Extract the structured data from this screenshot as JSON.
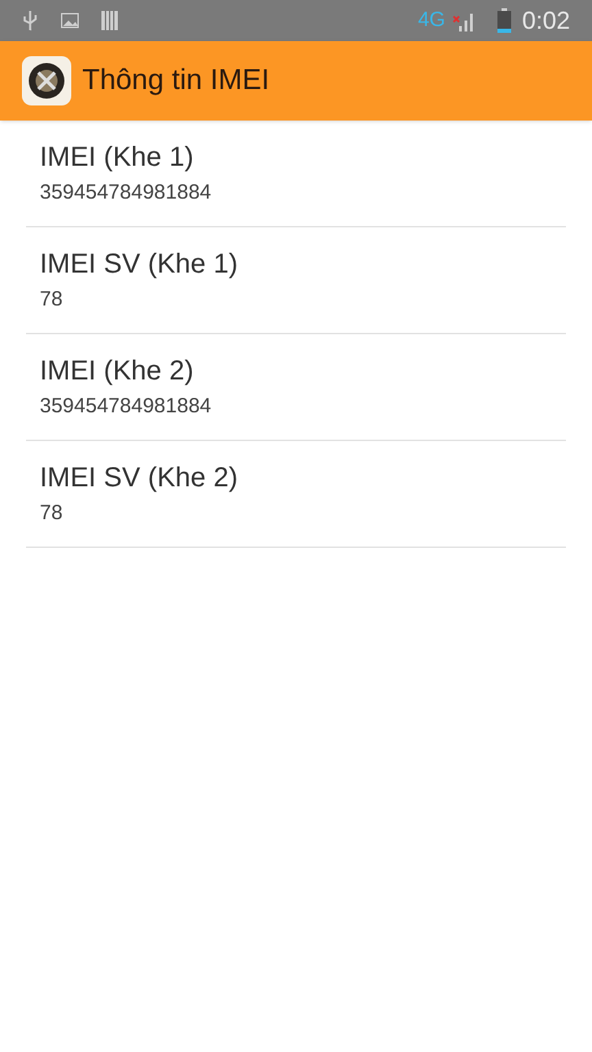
{
  "status_bar": {
    "network": "4G",
    "time": "0:02"
  },
  "app_bar": {
    "title": "Thông tin IMEI"
  },
  "items": [
    {
      "title": "IMEI (Khe 1)",
      "value": "359454784981884"
    },
    {
      "title": "IMEI SV (Khe 1)",
      "value": "78"
    },
    {
      "title": "IMEI (Khe 2)",
      "value": "359454784981884"
    },
    {
      "title": "IMEI SV (Khe 2)",
      "value": "78"
    }
  ]
}
